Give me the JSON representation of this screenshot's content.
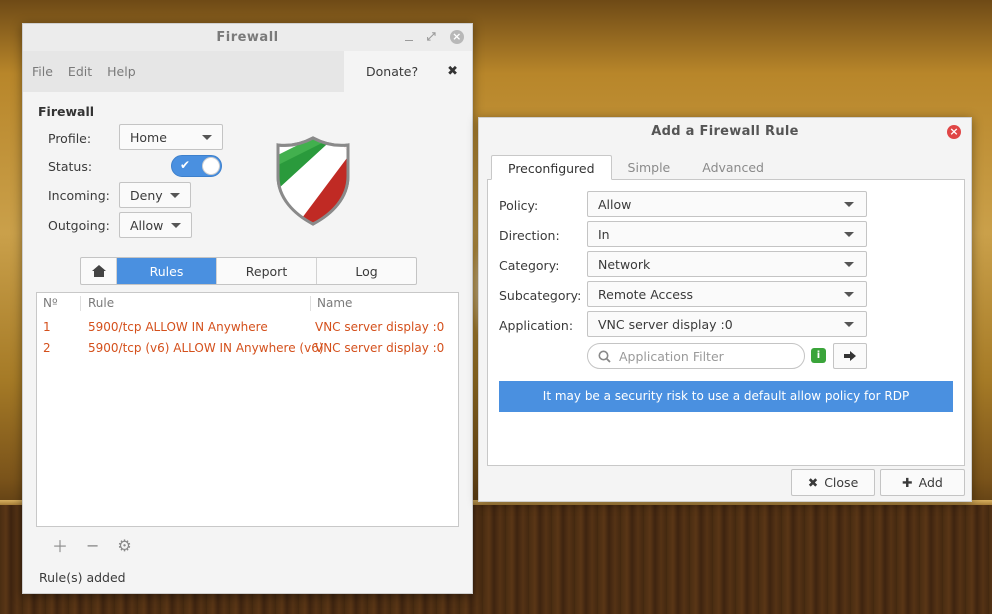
{
  "main_window": {
    "title": "Firewall",
    "menu": [
      "File",
      "Edit",
      "Help"
    ],
    "donate_label": "Donate?",
    "section_title": "Firewall",
    "profile": {
      "label": "Profile:",
      "value": "Home"
    },
    "status": {
      "label": "Status:",
      "enabled": true
    },
    "incoming": {
      "label": "Incoming:",
      "value": "Deny"
    },
    "outgoing": {
      "label": "Outgoing:",
      "value": "Allow"
    },
    "tabs": {
      "rules": "Rules",
      "report": "Report",
      "log": "Log",
      "active": "rules"
    },
    "rules_table": {
      "columns": [
        "Nº",
        "Rule",
        "Name"
      ],
      "rows": [
        {
          "no": "1",
          "rule": "5900/tcp ALLOW IN Anywhere",
          "name": "VNC server display :0"
        },
        {
          "no": "2",
          "rule": "5900/tcp (v6) ALLOW IN Anywhere (v6)",
          "name": "VNC server display :0"
        }
      ]
    },
    "status_bar": "Rule(s) added"
  },
  "dialog": {
    "title": "Add a Firewall Rule",
    "tabs": [
      "Preconfigured",
      "Simple",
      "Advanced"
    ],
    "active_tab": "Preconfigured",
    "fields": {
      "policy": {
        "label": "Policy:",
        "value": "Allow"
      },
      "direction": {
        "label": "Direction:",
        "value": "In"
      },
      "category": {
        "label": "Category:",
        "value": "Network"
      },
      "subcategory": {
        "label": "Subcategory:",
        "value": "Remote Access"
      },
      "application": {
        "label": "Application:",
        "value": "VNC server display :0"
      }
    },
    "filter_placeholder": "Application Filter",
    "warning": "It may be a security risk to use a default allow policy for RDP",
    "close_label": "Close",
    "add_label": "Add"
  },
  "colors": {
    "accent": "#4a90e0",
    "rule_text": "#d4501c",
    "dialog_close": "#e04646",
    "info_icon": "#3aa43a"
  },
  "icons": [
    "home-icon",
    "plus-icon",
    "minus-icon",
    "gear-icon",
    "search-icon",
    "info-icon",
    "arrow-right-icon",
    "close-icon",
    "shield-icon"
  ]
}
